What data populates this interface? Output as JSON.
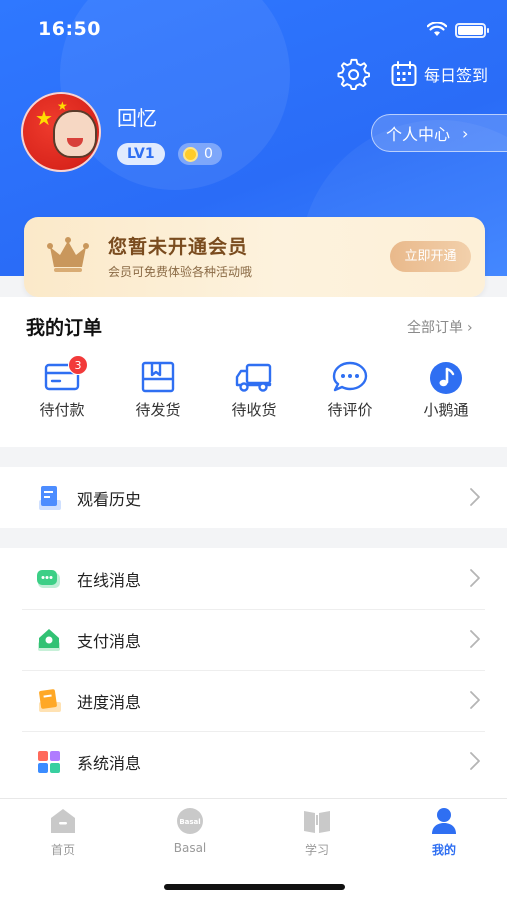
{
  "status_bar": {
    "time": "16:50"
  },
  "header": {
    "settings_icon": "gear-icon",
    "signin_label": "每日签到",
    "username": "回忆",
    "level": "LV1",
    "coins": "0",
    "center_label": "个人中心"
  },
  "membership": {
    "title": "您暂未开通会员",
    "subtitle": "会员可免费体验各种活动哦",
    "button": "立即开通"
  },
  "orders": {
    "title": "我的订单",
    "all_label": "全部订单",
    "items": [
      {
        "label": "待付款",
        "icon": "card-icon",
        "badge": "3"
      },
      {
        "label": "待发货",
        "icon": "package-icon"
      },
      {
        "label": "待收货",
        "icon": "truck-icon"
      },
      {
        "label": "待评价",
        "icon": "chat-icon"
      },
      {
        "label": "小鹅通",
        "icon": "music-note-icon"
      }
    ]
  },
  "history": {
    "label": "观看历史"
  },
  "messages": [
    {
      "label": "在线消息",
      "icon": "chat-bubble-icon"
    },
    {
      "label": "支付消息",
      "icon": "wallet-icon"
    },
    {
      "label": "进度消息",
      "icon": "progress-icon"
    },
    {
      "label": "系统消息",
      "icon": "grid-icon"
    }
  ],
  "tabbar": {
    "items": [
      {
        "label": "首页",
        "icon": "home-icon"
      },
      {
        "label": "Basal",
        "icon": "basal-icon"
      },
      {
        "label": "学习",
        "icon": "book-icon"
      },
      {
        "label": "我的",
        "icon": "profile-icon",
        "active": true
      }
    ]
  },
  "colors": {
    "primary": "#2f6ff2",
    "badge": "#f23a3a",
    "member_text": "#7a4c1f"
  }
}
